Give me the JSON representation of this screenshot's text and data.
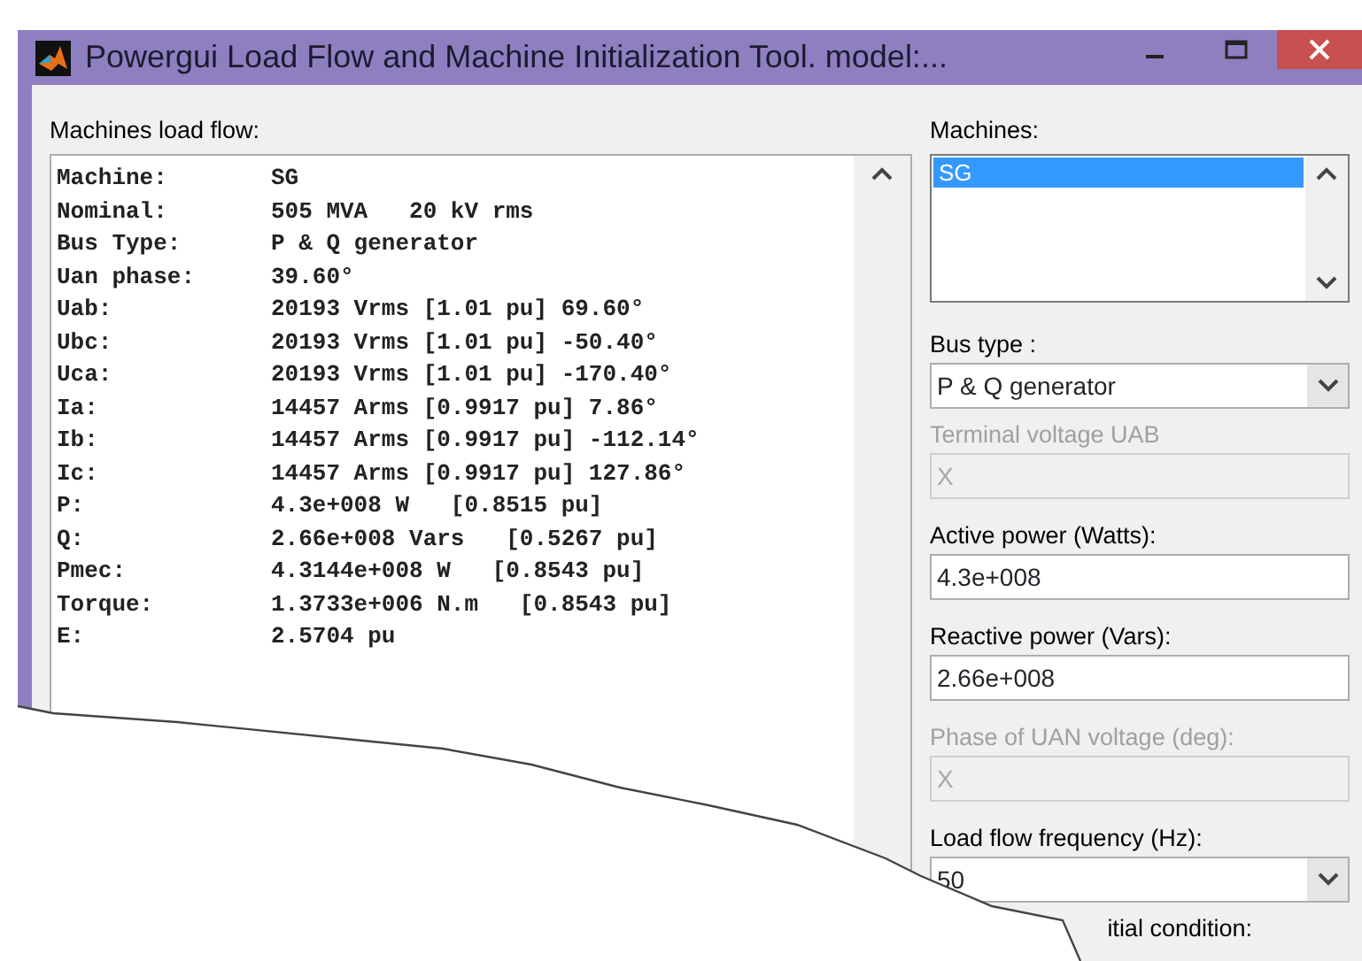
{
  "window": {
    "title": "Powergui Load Flow and Machine Initialization Tool.  model:..."
  },
  "load_flow": {
    "label": "Machines load flow:",
    "lines": [
      {
        "name": "Machine:",
        "value": "SG"
      },
      {
        "name": "Nominal:",
        "value": "505 MVA   20 kV rms"
      },
      {
        "name": "Bus Type:",
        "value": "P & Q generator"
      },
      {
        "name": "Uan phase:",
        "value": "39.60°"
      },
      {
        "name": "Uab:",
        "value": "20193 Vrms [1.01 pu] 69.60°"
      },
      {
        "name": "Ubc:",
        "value": "20193 Vrms [1.01 pu] -50.40°"
      },
      {
        "name": "Uca:",
        "value": "20193 Vrms [1.01 pu] -170.40°"
      },
      {
        "name": "Ia:",
        "value": "14457 Arms [0.9917 pu] 7.86°"
      },
      {
        "name": "Ib:",
        "value": "14457 Arms [0.9917 pu] -112.14°"
      },
      {
        "name": "Ic:",
        "value": "14457 Arms [0.9917 pu] 127.86°"
      },
      {
        "name": "P:",
        "value": "4.3e+008 W   [0.8515 pu]"
      },
      {
        "name": "Q:",
        "value": "2.66e+008 Vars   [0.5267 pu]"
      },
      {
        "name": "Pmec:",
        "value": "4.3144e+008 W   [0.8543 pu]"
      },
      {
        "name": "Torque:",
        "value": "1.3733e+006 N.m   [0.8543 pu]"
      },
      {
        "name": "E:",
        "value": "2.5704 pu"
      }
    ]
  },
  "machines": {
    "label": "Machines:",
    "items": [
      {
        "text": "SG",
        "selected": true
      }
    ]
  },
  "fields": [
    {
      "kind": "select",
      "label": "Bus type :",
      "value": "P & Q generator",
      "disabled": false
    },
    {
      "kind": "input",
      "label": "Terminal voltage UAB",
      "value": "X",
      "disabled": true
    },
    {
      "kind": "input",
      "label": "Active power (Watts):",
      "value": "4.3e+008",
      "disabled": false
    },
    {
      "kind": "input",
      "label": "Reactive power (Vars):",
      "value": "2.66e+008",
      "disabled": false
    },
    {
      "kind": "input",
      "label": "Phase of UAN voltage (deg):",
      "value": "X",
      "disabled": true
    },
    {
      "kind": "select",
      "label": "Load flow frequency (Hz):",
      "value": "50",
      "disabled": false
    },
    {
      "kind": "label",
      "label": "itial condition:"
    }
  ]
}
